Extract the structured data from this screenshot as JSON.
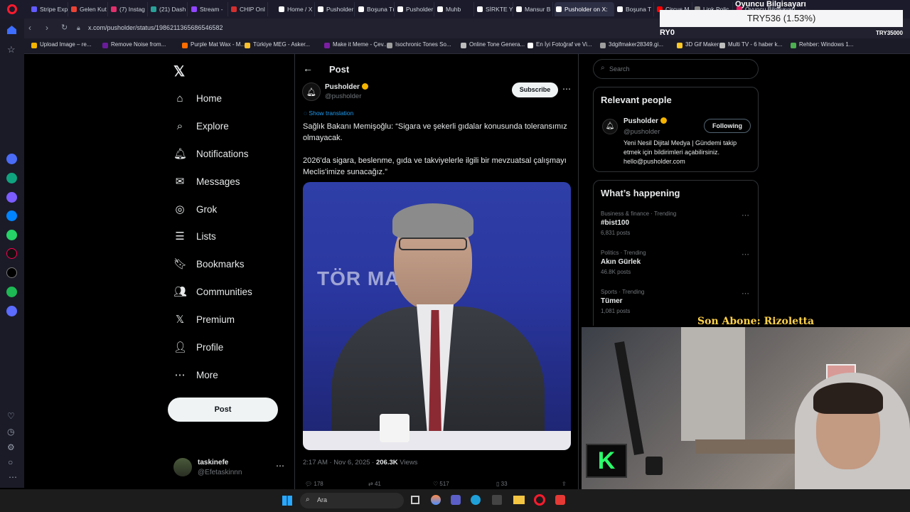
{
  "browser": {
    "tabs": [
      {
        "label": "Stripe Exp",
        "color": "#635bff"
      },
      {
        "label": "Gelen Kut",
        "color": "#ea4335"
      },
      {
        "label": "(7) Instag",
        "color": "#e1306c"
      },
      {
        "label": "(21) Dash",
        "color": "#2aa198"
      },
      {
        "label": "Stream -",
        "color": "#9146ff"
      },
      {
        "label": "CHIP Onl",
        "color": "#d32f2f"
      },
      {
        "label": "Home / X",
        "color": "#ffffff"
      },
      {
        "label": "Pusholder",
        "color": "#ffffff"
      },
      {
        "label": "Boşuna Tı",
        "color": "#ffffff"
      },
      {
        "label": "Pusholder",
        "color": "#ffffff"
      },
      {
        "label": "Muhb",
        "color": "#ffffff"
      },
      {
        "label": "SİRKTE YA",
        "color": "#ffffff"
      },
      {
        "label": "Mansur B",
        "color": "#ffffff"
      },
      {
        "label": "Pusholder on X:",
        "color": "#ffffff"
      },
      {
        "label": "Boşuna T",
        "color": "#ffffff"
      },
      {
        "label": "Circus M",
        "color": "#ff0000"
      },
      {
        "label": "Link Polic",
        "color": "#888888"
      },
      {
        "label": "Oyuncu Bilgisayarı",
        "color": "#e91e63"
      }
    ],
    "url": "x.com/pusholder/status/1986211365686546582",
    "bookmarks": [
      {
        "label": "Upload Image – re...",
        "color": "#f4b400"
      },
      {
        "label": "Remove Noise from...",
        "color": "#6a1b9a"
      },
      {
        "label": "Purple Mat Wax - M...",
        "color": "#ff6d00"
      },
      {
        "label": "Türkiye MEG - Asker...",
        "color": "#fbc02d"
      },
      {
        "label": "Make it Meme - Çev...",
        "color": "#7b1fa2"
      },
      {
        "label": "Isochronic Tones So...",
        "color": "#9e9e9e"
      },
      {
        "label": "Online Tone Genera...",
        "color": "#bdbdbd"
      },
      {
        "label": "En İyi Fotoğraf ve Vi...",
        "color": "#ffffff"
      },
      {
        "label": "3dgifmaker28349.gi...",
        "color": "#9e9e9e"
      },
      {
        "label": "3D Gif Maker",
        "color": "#ffca28"
      },
      {
        "label": "Multi TV - 6 haber k...",
        "color": "#bdbdbd"
      },
      {
        "label": "Rehber: Windows 1...",
        "color": "#4caf50"
      }
    ]
  },
  "overlay": {
    "ticker": "TRY536 (1.53%)",
    "ticker_small": "Oyuncu Bilgisayarı",
    "ticker_badge": "TRY35000",
    "ryo": "RY0",
    "subscriber": "Son Abone: Rizoletta"
  },
  "nav": {
    "items": [
      {
        "label": "Home",
        "icon": "home-icon"
      },
      {
        "label": "Explore",
        "icon": "search-icon"
      },
      {
        "label": "Notifications",
        "icon": "bell-icon"
      },
      {
        "label": "Messages",
        "icon": "envelope-icon"
      },
      {
        "label": "Grok",
        "icon": "grok-icon"
      },
      {
        "label": "Lists",
        "icon": "list-icon"
      },
      {
        "label": "Bookmarks",
        "icon": "bookmark-icon"
      },
      {
        "label": "Communities",
        "icon": "people-icon"
      },
      {
        "label": "Premium",
        "icon": "x-icon"
      },
      {
        "label": "Profile",
        "icon": "person-icon"
      },
      {
        "label": "More",
        "icon": "more-circle-icon"
      }
    ],
    "post_button": "Post",
    "account": {
      "name": "taskinefe",
      "handle": "@Efetaskinnn"
    }
  },
  "post": {
    "header": "Post",
    "author": "Pusholder",
    "handle": "@pusholder",
    "subscribe": "Subscribe",
    "show_translation": "Show translation",
    "text1": "Sağlık Bakanı Memişoğlu: “Sigara ve şekerli gıdalar konusunda toleransımız olmayacak.",
    "text2": "2026'da sigara, beslenme, gıda ve takviyelerle ilgili bir mevzuatsal çalışmayı Meclis'imize sunacağız.”",
    "image_text": "TÖR MASASI",
    "timestamp": "2:17 AM · Nov 6, 2025 ·",
    "views_count": "206.3K",
    "views_label": "Views",
    "replies": "178",
    "reposts": "41",
    "likes": "517",
    "bookmarks": "33"
  },
  "sidebar": {
    "search_placeholder": "Search",
    "relevant_title": "Relevant people",
    "person": {
      "name": "Pusholder",
      "handle": "@pusholder",
      "button": "Following",
      "bio": "Yeni Nesil Dijital Medya | Gündemi takip etmek için bildirimleri açabilirsiniz. hello@pusholder.com"
    },
    "happening_title": "What’s happening",
    "trends": [
      {
        "context": "Business & finance · Trending",
        "topic": "#bist100",
        "posts": "6,831 posts"
      },
      {
        "context": "Politics · Trending",
        "topic": "Akın Gürlek",
        "posts": "46.8K posts"
      },
      {
        "context": "Sports · Trending",
        "topic": "Tümer",
        "posts": "1,081 posts"
      }
    ]
  },
  "taskbar": {
    "search": "Ara"
  },
  "colors": {
    "bg": "#000000",
    "text": "#e7e9ea",
    "muted": "#71767b",
    "verified": "#f4b400",
    "translate": "#1d9bf0"
  }
}
